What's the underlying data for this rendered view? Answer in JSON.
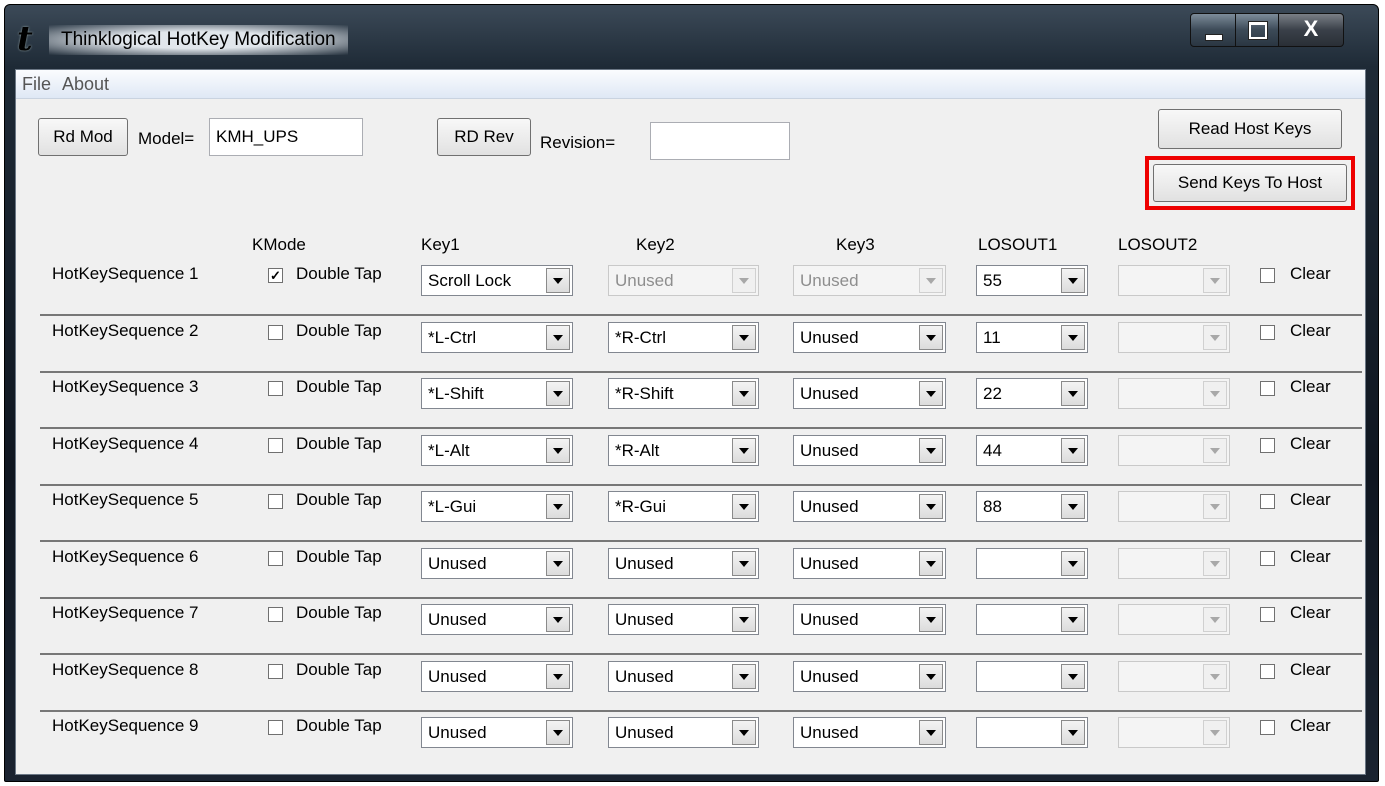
{
  "window": {
    "title": "Thinklogical HotKey Modification",
    "close_glyph": "X"
  },
  "menu": {
    "file": "File",
    "about": "About"
  },
  "top": {
    "rd_mod": "Rd Mod",
    "model_label": "Model=",
    "model_value": "KMH_UPS",
    "rd_rev": "RD Rev",
    "revision_label": "Revision=",
    "revision_value": "",
    "read_host_keys": "Read Host Keys",
    "send_keys_to_host": "Send Keys To Host"
  },
  "headers": {
    "kmode": "KMode",
    "key1": "Key1",
    "key2": "Key2",
    "key3": "Key3",
    "losout1": "LOSOUT1",
    "losout2": "LOSOUT2"
  },
  "labels": {
    "double_tap": "Double Tap",
    "clear": "Clear",
    "check_mark": "✓"
  },
  "rows": [
    {
      "name": "HotKeySequence 1",
      "double_tap": true,
      "key1": "Scroll Lock",
      "key2": "Unused",
      "key3": "Unused",
      "los1": "55",
      "los2": "",
      "key2_disabled": true,
      "key3_disabled": true
    },
    {
      "name": "HotKeySequence 2",
      "double_tap": false,
      "key1": "*L-Ctrl",
      "key2": "*R-Ctrl",
      "key3": "Unused",
      "los1": "11",
      "los2": ""
    },
    {
      "name": "HotKeySequence 3",
      "double_tap": false,
      "key1": "*L-Shift",
      "key2": "*R-Shift",
      "key3": "Unused",
      "los1": "22",
      "los2": ""
    },
    {
      "name": "HotKeySequence 4",
      "double_tap": false,
      "key1": "*L-Alt",
      "key2": "*R-Alt",
      "key3": "Unused",
      "los1": "44",
      "los2": ""
    },
    {
      "name": "HotKeySequence 5",
      "double_tap": false,
      "key1": "*L-Gui",
      "key2": "*R-Gui",
      "key3": "Unused",
      "los1": "88",
      "los2": ""
    },
    {
      "name": "HotKeySequence 6",
      "double_tap": false,
      "key1": "Unused",
      "key2": "Unused",
      "key3": "Unused",
      "los1": "",
      "los2": ""
    },
    {
      "name": "HotKeySequence 7",
      "double_tap": false,
      "key1": "Unused",
      "key2": "Unused",
      "key3": "Unused",
      "los1": "",
      "los2": ""
    },
    {
      "name": "HotKeySequence 8",
      "double_tap": false,
      "key1": "Unused",
      "key2": "Unused",
      "key3": "Unused",
      "los1": "",
      "los2": ""
    },
    {
      "name": "HotKeySequence 9",
      "double_tap": false,
      "key1": "Unused",
      "key2": "Unused",
      "key3": "Unused",
      "los1": "",
      "los2": ""
    }
  ],
  "colors": {
    "highlight": "#ee0000",
    "disabled_text": "#8e8e8e"
  },
  "icons": [
    "thinklogical-logo-icon",
    "minimize-icon",
    "maximize-icon",
    "close-icon",
    "dropdown-arrow-icon",
    "checkbox-icon"
  ]
}
